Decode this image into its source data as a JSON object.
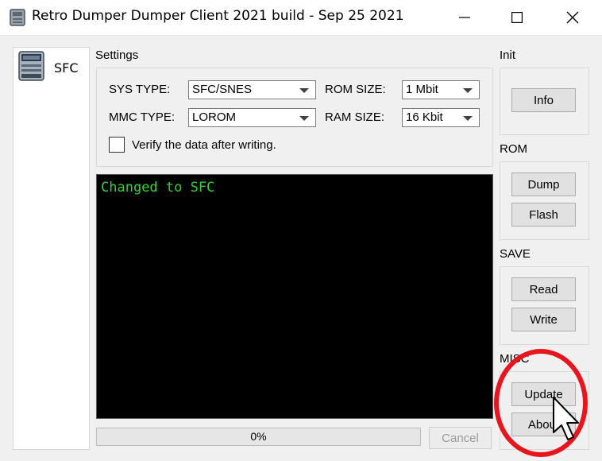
{
  "window": {
    "title": "Retro Dumper Dumper Client 2021 build - Sep 25 2021",
    "controls": [
      "minimize-icon",
      "maximize-icon",
      "close-icon"
    ]
  },
  "sidebar": {
    "items": [
      {
        "label": "SFC",
        "icon": "console-cartridge-icon"
      }
    ]
  },
  "settings": {
    "title": "Settings",
    "sys_type_label": "SYS TYPE:",
    "sys_type_value": "SFC/SNES",
    "mmc_type_label": "MMC TYPE:",
    "mmc_type_value": "LOROM",
    "rom_size_label": "ROM SIZE:",
    "rom_size_value": "1 Mbit",
    "ram_size_label": "RAM SIZE:",
    "ram_size_value": "16 Kbit",
    "verify_label": "Verify the data after writing.",
    "verify_checked": false
  },
  "console": {
    "text": "Changed to SFC",
    "text_color": "#2fd22f"
  },
  "progress": {
    "percent": 0,
    "label": "0%",
    "cancel_label": "Cancel"
  },
  "groups": {
    "init": {
      "title": "Init",
      "buttons": [
        "Info"
      ]
    },
    "rom": {
      "title": "ROM",
      "buttons": [
        "Dump",
        "Flash"
      ]
    },
    "save": {
      "title": "SAVE",
      "buttons": [
        "Read",
        "Write"
      ]
    },
    "misc": {
      "title": "MISC",
      "buttons": [
        "Update",
        "About"
      ]
    }
  },
  "annotation": {
    "color": "#e8141e"
  }
}
